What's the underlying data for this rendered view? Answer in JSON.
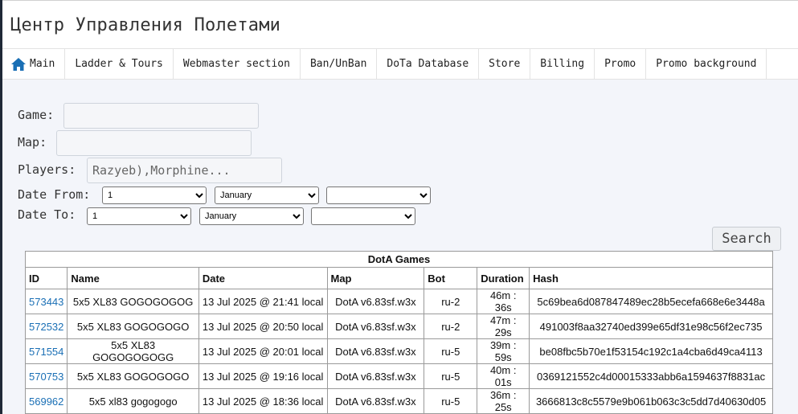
{
  "header": {
    "title": "Центр Управления Полетами"
  },
  "nav": {
    "items": [
      {
        "label": "Main",
        "icon": "home-icon"
      },
      {
        "label": "Ladder & Tours"
      },
      {
        "label": "Webmaster section"
      },
      {
        "label": "Ban/UnBan"
      },
      {
        "label": "DoTa Database"
      },
      {
        "label": "Store"
      },
      {
        "label": "Billing"
      },
      {
        "label": "Promo"
      },
      {
        "label": "Promo background"
      }
    ]
  },
  "form": {
    "game_label": "Game:",
    "game_value": "",
    "map_label": "Map:",
    "map_value": "",
    "players_label": "Players:",
    "players_value": "Razyeb),Morphine...",
    "date_from_label": "Date From:",
    "date_to_label": "Date To:",
    "date_from": {
      "day": "1",
      "month": "January",
      "year": ""
    },
    "date_to": {
      "day": "1",
      "month": "January",
      "year": ""
    },
    "search_label": "Search"
  },
  "table": {
    "caption": "DotA Games",
    "headers": [
      "ID",
      "Name",
      "Date",
      "Map",
      "Bot",
      "Duration",
      "Hash"
    ],
    "rows": [
      [
        "573443",
        "5x5 XL83 GOGOGOGOG",
        "13 Jul 2025 @ 21:41 local",
        "DotA v6.83sf.w3x",
        "ru-2",
        "46m : 36s",
        "5c69bea6d087847489ec28b5ecefa668e6e3448a"
      ],
      [
        "572532",
        "5x5 XL83 GOGOGOGO",
        "13 Jul 2025 @ 20:50 local",
        "DotA v6.83sf.w3x",
        "ru-2",
        "47m : 29s",
        "491003f8aa32740ed399e65df31e98c56f2ec735"
      ],
      [
        "571554",
        "5x5 XL83 GOGOGOGOGG",
        "13 Jul 2025 @ 20:01 local",
        "DotA v6.83sf.w3x",
        "ru-5",
        "39m : 59s",
        "be08fbc5b70e1f53154c192c1a4cba6d49ca4113"
      ],
      [
        "570753",
        "5x5 XL83 GOGOGOGO",
        "13 Jul 2025 @ 19:16 local",
        "DotA v6.83sf.w3x",
        "ru-5",
        "40m : 01s",
        "0369121552c4d00015333abb6a1594637f8831ac"
      ],
      [
        "569962",
        "5x5 xl83 gogogogo",
        "13 Jul 2025 @ 18:36 local",
        "DotA v6.83sf.w3x",
        "ru-5",
        "36m : 25s",
        "3666813c8c5579e9b061b063c3c5dd7d40630d05"
      ]
    ]
  },
  "colors": {
    "link": "#1a6fb5",
    "home_icon": "#1a6fb5",
    "page_bg": "#f3f5fa"
  }
}
